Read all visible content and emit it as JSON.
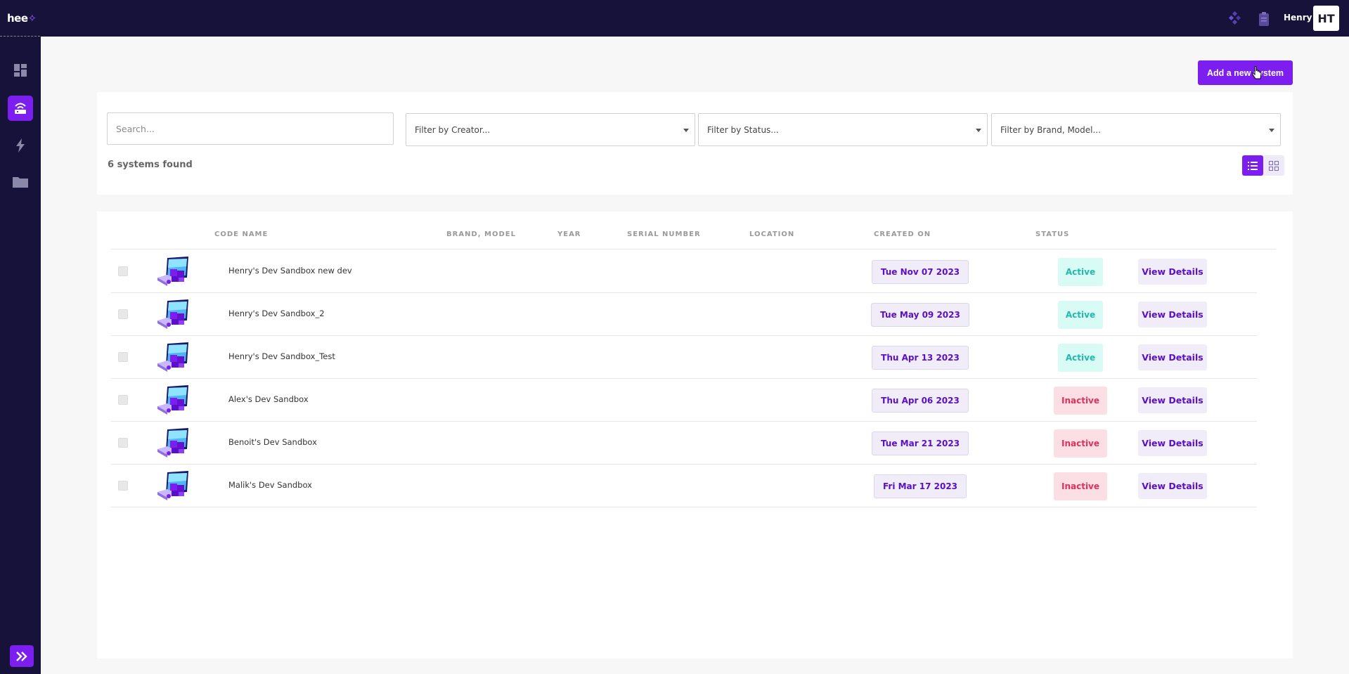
{
  "app": {
    "logo_text": "hee",
    "logo_accent": "✧",
    "brand_color": "#7d1ef0",
    "topbar_color": "#16123a"
  },
  "user": {
    "name": "Henry",
    "initials": "HT"
  },
  "toolbar": {
    "add_button_label": "Add a new system"
  },
  "filters": {
    "search_placeholder": "Search...",
    "creator_placeholder": "Filter by Creator...",
    "status_placeholder": "Filter by Status...",
    "brand_placeholder": "Filter by Brand, Model...",
    "count_label": "6 systems found"
  },
  "table": {
    "headers": [
      "CODE NAME",
      "BRAND, MODEL",
      "YEAR",
      "SERIAL NUMBER",
      "LOCATION",
      "CREATED ON",
      "STATUS"
    ],
    "rows": [
      {
        "code_name": "Henry's Dev Sandbox new dev",
        "created_on": "Tue Nov 07 2023",
        "status": "Active",
        "action": "View Details"
      },
      {
        "code_name": "Henry's Dev Sandbox_2",
        "created_on": "Tue May 09 2023",
        "status": "Active",
        "action": "View Details"
      },
      {
        "code_name": "Henry's Dev Sandbox_Test",
        "created_on": "Thu Apr 13 2023",
        "status": "Active",
        "action": "View Details"
      },
      {
        "code_name": "Alex's Dev Sandbox",
        "created_on": "Thu Apr 06 2023",
        "status": "Inactive",
        "action": "View Details"
      },
      {
        "code_name": "Benoit's Dev Sandbox",
        "created_on": "Tue Mar 21 2023",
        "status": "Inactive",
        "action": "View Details"
      },
      {
        "code_name": "Malik's Dev Sandbox",
        "created_on": "Fri Mar 17 2023",
        "status": "Inactive",
        "action": "View Details"
      }
    ]
  },
  "icons": {
    "sidebar": [
      "dashboard-icon",
      "router-icon",
      "lightning-icon",
      "folder-icon"
    ],
    "top": [
      "diamond-icon",
      "clipboard-icon"
    ]
  }
}
